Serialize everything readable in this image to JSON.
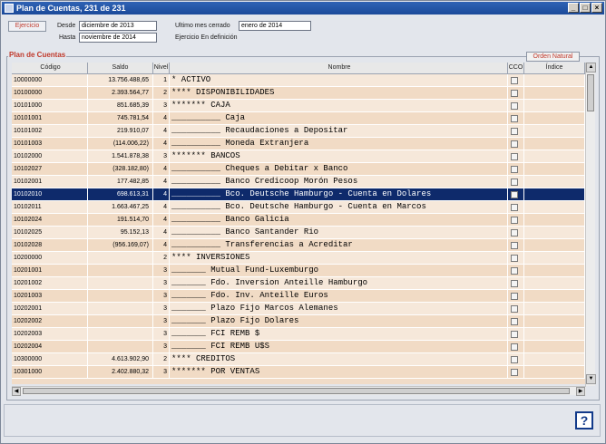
{
  "window": {
    "title": "Plan de Cuentas, 231 de 231",
    "minimize_label": "_",
    "maximize_label": "□",
    "close_label": "×"
  },
  "header": {
    "ejercicio_label": "Ejercicio",
    "desde_label": "Desde",
    "desde_value": "diciembre de 2013",
    "hasta_label": "Hasta",
    "hasta_value": "noviembre de 2014",
    "ultimo_mes_label": "Ultimo mes cerrado",
    "ultimo_mes_value": "enero de 2014",
    "estado": "Ejercicio En definición"
  },
  "group_title": "Plan de Cuentas",
  "orden_label": "Orden Natural",
  "columns": {
    "codigo": "Código",
    "saldo": "Saldo",
    "nivel": "Nivel",
    "nombre": "Nombre",
    "cco": "CCO",
    "indice": "Índice"
  },
  "rows": [
    {
      "codigo": "10000000",
      "saldo": "13.756.488,65",
      "nivel": "1",
      "nombre": "* ACTIVO"
    },
    {
      "codigo": "10100000",
      "saldo": "2.393.564,77",
      "nivel": "2",
      "nombre": "**** DISPONIBILIDADES"
    },
    {
      "codigo": "10101000",
      "saldo": "851.685,39",
      "nivel": "3",
      "nombre": "******* CAJA"
    },
    {
      "codigo": "10101001",
      "saldo": "745.781,54",
      "nivel": "4",
      "nombre": "__________ Caja"
    },
    {
      "codigo": "10101002",
      "saldo": "219.910,07",
      "nivel": "4",
      "nombre": "__________ Recaudaciones a Depositar"
    },
    {
      "codigo": "10101003",
      "saldo": "(114.006,22)",
      "nivel": "4",
      "nombre": "__________ Moneda Extranjera"
    },
    {
      "codigo": "10102000",
      "saldo": "1.541.878,38",
      "nivel": "3",
      "nombre": "******* BANCOS"
    },
    {
      "codigo": "10102027",
      "saldo": "(328.182,80)",
      "nivel": "4",
      "nombre": "__________ Cheques a Debitar x Banco"
    },
    {
      "codigo": "10102001",
      "saldo": "177.482,85",
      "nivel": "4",
      "nombre": "__________ Banco Credicoop Morón Pesos"
    },
    {
      "codigo": "10102010",
      "saldo": "698.613,31",
      "nivel": "4",
      "nombre": "__________ Bco. Deutsche Hamburgo - Cuenta en Dolares",
      "selected": true
    },
    {
      "codigo": "10102011",
      "saldo": "1.663.467,25",
      "nivel": "4",
      "nombre": "__________ Bco. Deutsche Hamburgo - Cuenta en Marcos"
    },
    {
      "codigo": "10102024",
      "saldo": "191.514,70",
      "nivel": "4",
      "nombre": "__________ Banco Galicia"
    },
    {
      "codigo": "10102025",
      "saldo": "95.152,13",
      "nivel": "4",
      "nombre": "__________ Banco Santander Rio"
    },
    {
      "codigo": "10102028",
      "saldo": "(956.169,07)",
      "nivel": "4",
      "nombre": "__________ Transferencias a Acreditar"
    },
    {
      "codigo": "10200000",
      "saldo": "",
      "nivel": "2",
      "nombre": "**** INVERSIONES"
    },
    {
      "codigo": "10201001",
      "saldo": "",
      "nivel": "3",
      "nombre": "_______ Mutual Fund-Luxemburgo"
    },
    {
      "codigo": "10201002",
      "saldo": "",
      "nivel": "3",
      "nombre": "_______ Fdo. Inversion Anteille Hamburgo"
    },
    {
      "codigo": "10201003",
      "saldo": "",
      "nivel": "3",
      "nombre": "_______ Fdo. Inv. Anteille Euros"
    },
    {
      "codigo": "10202001",
      "saldo": "",
      "nivel": "3",
      "nombre": "_______ Plazo Fijo Marcos Alemanes"
    },
    {
      "codigo": "10202002",
      "saldo": "",
      "nivel": "3",
      "nombre": "_______ Plazo Fijo Dolares"
    },
    {
      "codigo": "10202003",
      "saldo": "",
      "nivel": "3",
      "nombre": "_______ FCI REMB $"
    },
    {
      "codigo": "10202004",
      "saldo": "",
      "nivel": "3",
      "nombre": "_______ FCI REMB U$S"
    },
    {
      "codigo": "10300000",
      "saldo": "4.613.902,90",
      "nivel": "2",
      "nombre": "**** CREDITOS"
    },
    {
      "codigo": "10301000",
      "saldo": "2.402.880,32",
      "nivel": "3",
      "nombre": "******* POR VENTAS"
    }
  ],
  "help_label": "?"
}
